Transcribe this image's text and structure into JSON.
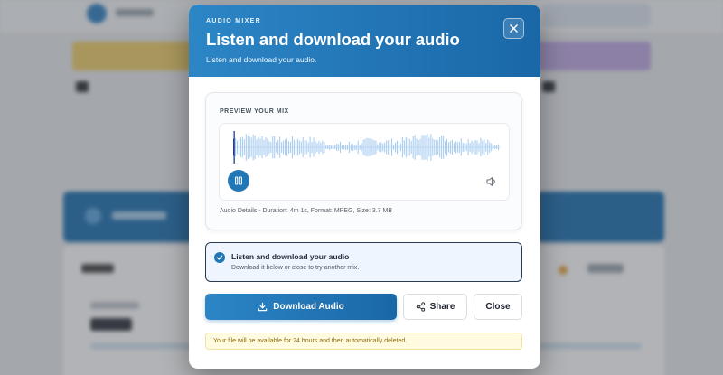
{
  "modal": {
    "eyebrow": "AUDIO MIXER",
    "title": "Listen and download your audio",
    "subtitle": "Listen and download your audio.",
    "close_icon": "close-icon"
  },
  "preview": {
    "label": "PREVIEW YOUR MIX",
    "play_state_icon": "pause-icon",
    "volume_icon": "volume-icon",
    "audio_details": "Audio Details - Duration: 4m 1s, Format: MPEG, Size: 3.7 MB",
    "played_color": "#1e3f8a",
    "wave_color": "#a9cdf0"
  },
  "status": {
    "title": "Listen and download your audio",
    "subtitle": "Download it below or close to try another mix.",
    "icon": "check-circle-icon"
  },
  "actions": {
    "download_label": "Download Audio",
    "share_label": "Share",
    "close_label": "Close"
  },
  "notice": "Your file will be available for 24 hours and then automatically deleted.",
  "colors": {
    "accent": "#2176b6",
    "accent_dark": "#1a67a7",
    "notice_bg": "#fffbe0"
  }
}
